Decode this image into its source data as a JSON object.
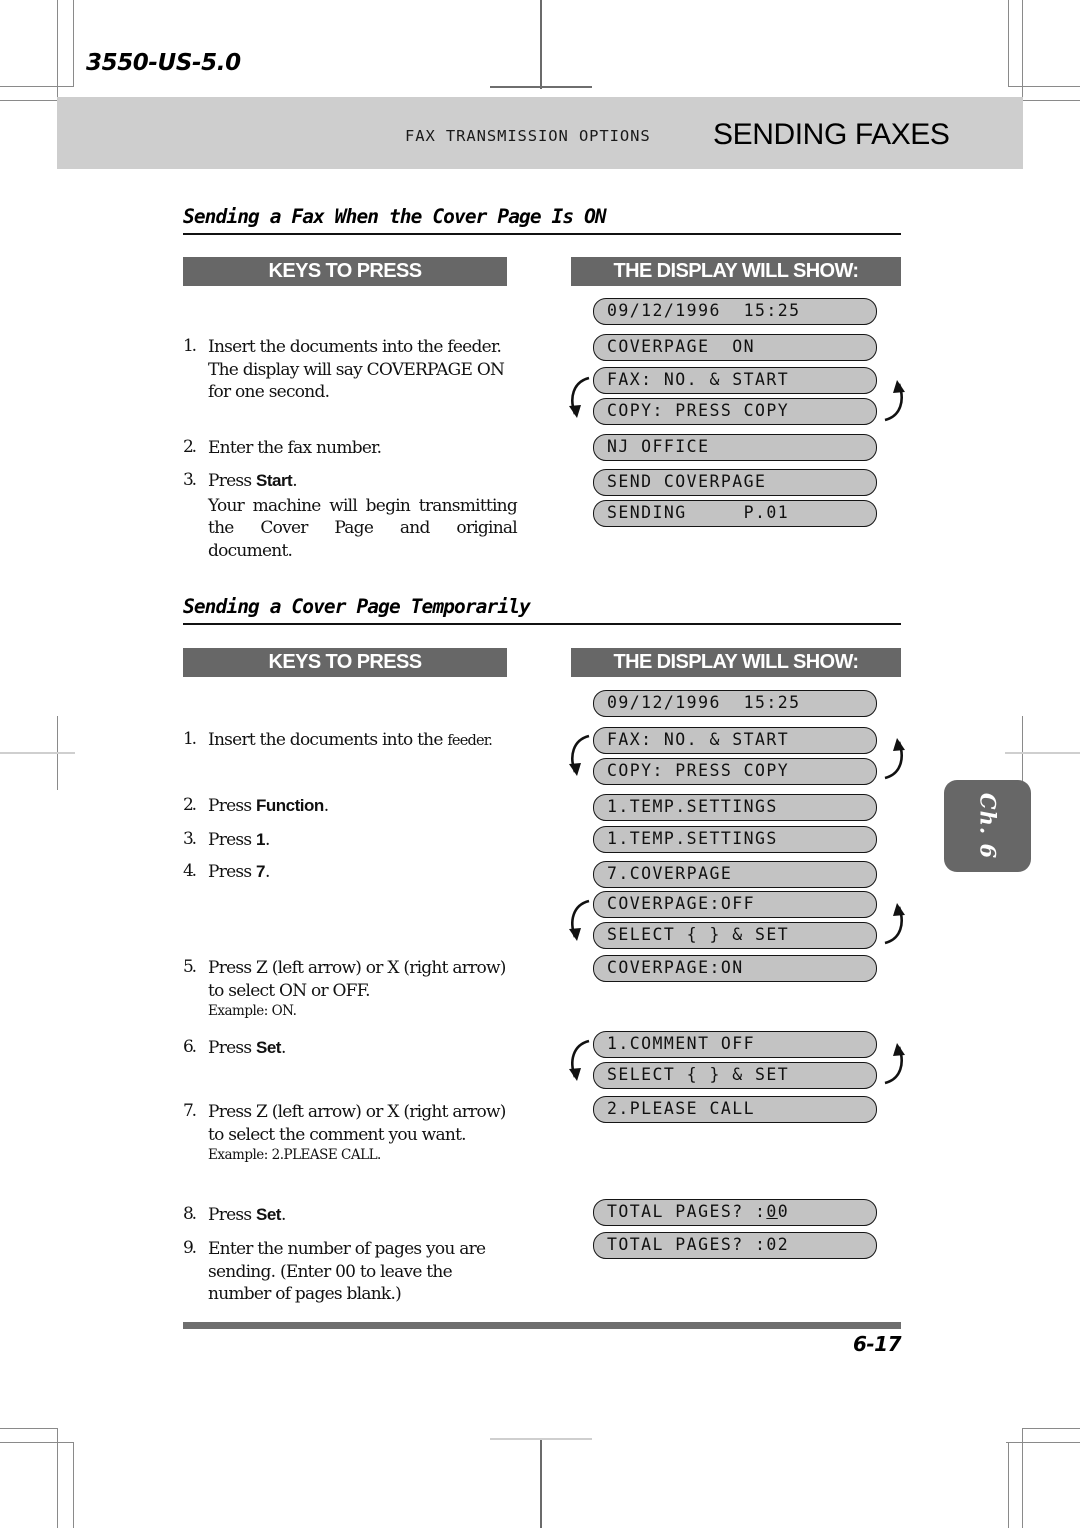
{
  "header": {
    "doc_code": "3550-US-5.0",
    "kicker": "FAX TRANSMISSION OPTIONS",
    "title": "SENDING FAXES"
  },
  "chapter_tab": {
    "label": "Ch. 6"
  },
  "footer": {
    "page_number": "6-17"
  },
  "column_headers": {
    "keys": "KEYS TO PRESS",
    "display": "THE DISPLAY WILL SHOW:"
  },
  "sections": [
    {
      "heading": "Sending a Fax When the Cover Page Is ON",
      "steps": [
        {
          "num": "1.",
          "text": "Insert the documents into the feeder. The display will say COVERPAGE ON for one second."
        },
        {
          "num": "2.",
          "text": "Enter the fax number."
        },
        {
          "num": "3.",
          "lead": "Press ",
          "bold": "Start",
          "trail": ".",
          "text": "Your machine will begin transmitting the Cover Page and original document."
        }
      ],
      "displays": [
        "09/12/1996  15:25",
        "COVERPAGE  ON",
        "FAX: NO. & START",
        "COPY: PRESS COPY",
        "NJ OFFICE",
        "SEND COVERPAGE",
        "SENDING     P.01"
      ]
    },
    {
      "heading": "Sending a Cover Page Temporarily",
      "steps": [
        {
          "num": "1.",
          "text": "Insert the documents into the ",
          "text2": "feeder."
        },
        {
          "num": "2.",
          "lead": "Press ",
          "bold": "Function",
          "trail": "."
        },
        {
          "num": "3.",
          "lead": "Press ",
          "bold": "1",
          "trail": "."
        },
        {
          "num": "4.",
          "lead": "Press ",
          "bold": "7",
          "trail": "."
        },
        {
          "num": "5.",
          "text": "Press Z (left arrow) or X (right arrow) to select ON or OFF.",
          "example": "Example: ON."
        },
        {
          "num": "6.",
          "lead": "Press ",
          "bold": "Set",
          "trail": "."
        },
        {
          "num": "7.",
          "text": "Press Z (left arrow) or X (right arrow) to select the comment you want.",
          "example": "Example: 2.PLEASE CALL."
        },
        {
          "num": "8.",
          "lead": "Press ",
          "bold": "Set",
          "trail": "."
        },
        {
          "num": "9.",
          "text": "Enter the number of pages you are sending. (Enter 00 to leave the number of pages blank.)"
        }
      ],
      "displays": [
        "09/12/1996  15:25",
        "FAX: NO. & START",
        "COPY: PRESS COPY",
        "1.TEMP.SETTINGS",
        "1.TEMP.SETTINGS",
        "7.COVERPAGE",
        "COVERPAGE:OFF",
        "SELECT { } & SET",
        "COVERPAGE:ON",
        "1.COMMENT OFF",
        "SELECT { } & SET",
        "2.PLEASE CALL",
        "TOTAL PAGES? :00",
        "TOTAL PAGES? :02"
      ]
    }
  ],
  "colors": {
    "header_band": "#cecece",
    "column_bar": "#676767",
    "lcd_fill": "#c3c3c3",
    "footer_rule": "#6e6e6e"
  }
}
